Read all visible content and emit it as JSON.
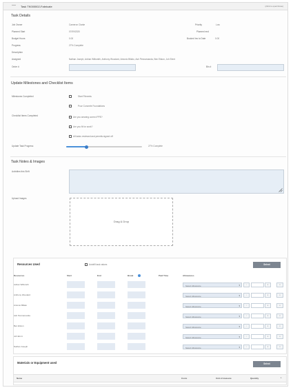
{
  "window": {
    "title": "Task TK000002-Fabricate",
    "hint": "(click to open/close)",
    "collapse_symbol": "—"
  },
  "details": {
    "heading": "Task Details",
    "job_owner_label": "Job Owner",
    "job_owner_value": "Cameron Clarke",
    "priority_label": "Priority",
    "priority_value": "Low",
    "planned_start_label": "Planned Start",
    "planned_start_value": "07/09/2020",
    "planned_end_label": "Planned end",
    "budget_hours_label": "Budget Hours",
    "budget_hours_value": "0.00",
    "booked_label": "Booked hrs to Date",
    "booked_value": "0.00",
    "progress_label": "Progress",
    "progress_value": "27% Complete",
    "description_label": "Description",
    "assigned_label": "Assigned",
    "assigned_value": "Nathan Joseph, Adrian Willsmith, Anthony Woodard, Antonio Billalo, Ash Pennamanda, Ben Elston, Joh Elmrt",
    "order_label": "Order #",
    "bin_label": "Bin #"
  },
  "milestones": {
    "heading": "Update Milestones and Checklist Items",
    "completed_label": "Milestones Completed",
    "items": [
      "Start Fitments",
      "Pour Concrete Foundations"
    ],
    "checklist_label": "Checklist Items Completed",
    "checklist": [
      "Are you wearing correct PPE?",
      "Are you fit for work?",
      "All tasks reviewed and permits signed off"
    ],
    "progress_label": "Update Task Progress",
    "progress_text": "27% Complete",
    "progress_fraction": 0.27
  },
  "notes": {
    "heading": "Task Notes & Images",
    "activities_label": "Activities this Shift",
    "upload_label": "Upload Images",
    "drop_text": "Drag & Drop"
  },
  "resources": {
    "heading": "Resources Used",
    "autofill_label": "Autofill task values",
    "select_button": "Select",
    "columns": [
      "Resources",
      "Start",
      "End",
      "Break",
      "Paid Time",
      "Allowances"
    ],
    "select_placeholder": "Select Allowance",
    "names": [
      "Adrian Willsmith",
      "Anthony Woodard",
      "Antonio Billalo",
      "Ash Pennamanda",
      "Ben Elston",
      "Joh Elmrt",
      "Nathan Joseph"
    ]
  },
  "materials": {
    "heading": "Materials or Equipment used",
    "select_button": "Select",
    "columns": [
      "Name",
      "Costs",
      "Unit of measure",
      "Quantity"
    ]
  }
}
